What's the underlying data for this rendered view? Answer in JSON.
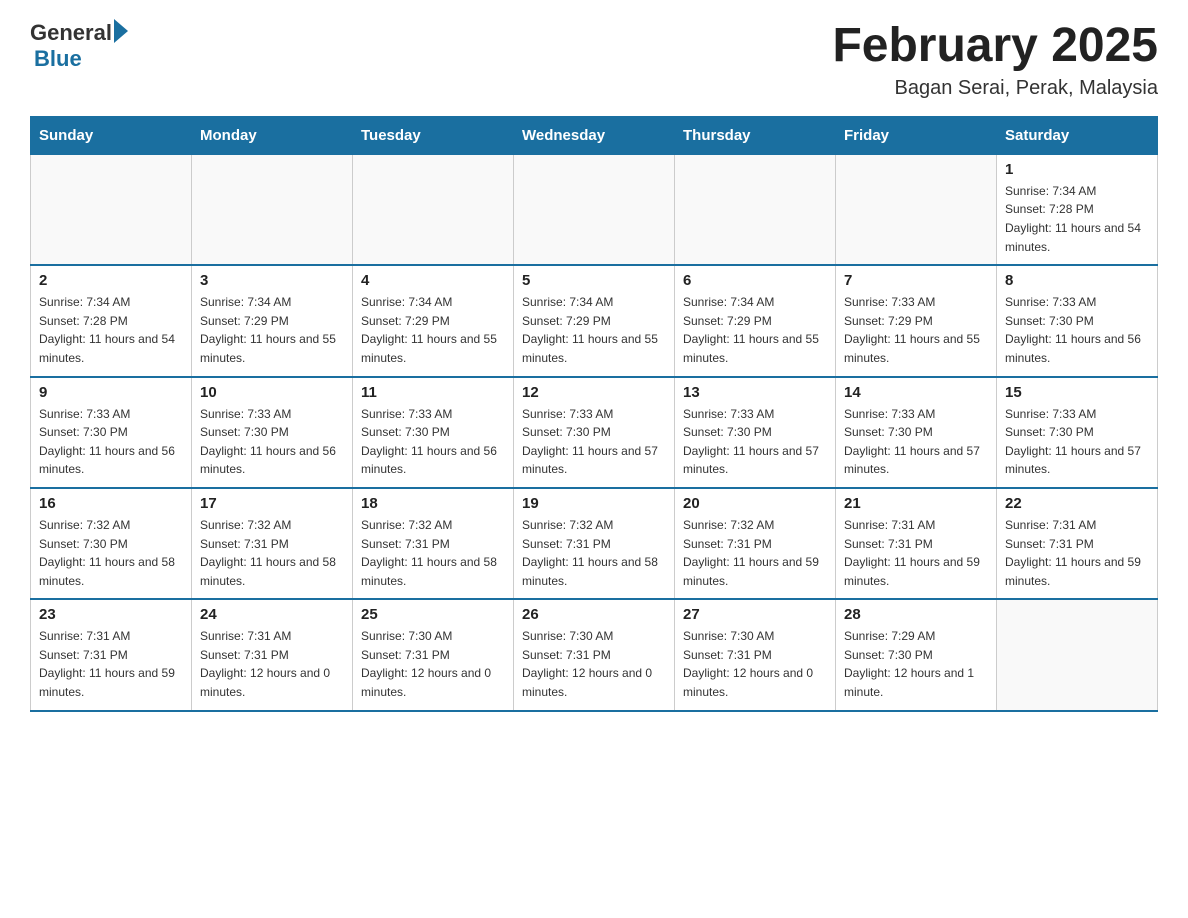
{
  "header": {
    "logo_general": "General",
    "logo_blue": "Blue",
    "month_title": "February 2025",
    "location": "Bagan Serai, Perak, Malaysia"
  },
  "days_of_week": [
    "Sunday",
    "Monday",
    "Tuesday",
    "Wednesday",
    "Thursday",
    "Friday",
    "Saturday"
  ],
  "weeks": [
    [
      {
        "day": "",
        "sunrise": "",
        "sunset": "",
        "daylight": ""
      },
      {
        "day": "",
        "sunrise": "",
        "sunset": "",
        "daylight": ""
      },
      {
        "day": "",
        "sunrise": "",
        "sunset": "",
        "daylight": ""
      },
      {
        "day": "",
        "sunrise": "",
        "sunset": "",
        "daylight": ""
      },
      {
        "day": "",
        "sunrise": "",
        "sunset": "",
        "daylight": ""
      },
      {
        "day": "",
        "sunrise": "",
        "sunset": "",
        "daylight": ""
      },
      {
        "day": "1",
        "sunrise": "Sunrise: 7:34 AM",
        "sunset": "Sunset: 7:28 PM",
        "daylight": "Daylight: 11 hours and 54 minutes."
      }
    ],
    [
      {
        "day": "2",
        "sunrise": "Sunrise: 7:34 AM",
        "sunset": "Sunset: 7:28 PM",
        "daylight": "Daylight: 11 hours and 54 minutes."
      },
      {
        "day": "3",
        "sunrise": "Sunrise: 7:34 AM",
        "sunset": "Sunset: 7:29 PM",
        "daylight": "Daylight: 11 hours and 55 minutes."
      },
      {
        "day": "4",
        "sunrise": "Sunrise: 7:34 AM",
        "sunset": "Sunset: 7:29 PM",
        "daylight": "Daylight: 11 hours and 55 minutes."
      },
      {
        "day": "5",
        "sunrise": "Sunrise: 7:34 AM",
        "sunset": "Sunset: 7:29 PM",
        "daylight": "Daylight: 11 hours and 55 minutes."
      },
      {
        "day": "6",
        "sunrise": "Sunrise: 7:34 AM",
        "sunset": "Sunset: 7:29 PM",
        "daylight": "Daylight: 11 hours and 55 minutes."
      },
      {
        "day": "7",
        "sunrise": "Sunrise: 7:33 AM",
        "sunset": "Sunset: 7:29 PM",
        "daylight": "Daylight: 11 hours and 55 minutes."
      },
      {
        "day": "8",
        "sunrise": "Sunrise: 7:33 AM",
        "sunset": "Sunset: 7:30 PM",
        "daylight": "Daylight: 11 hours and 56 minutes."
      }
    ],
    [
      {
        "day": "9",
        "sunrise": "Sunrise: 7:33 AM",
        "sunset": "Sunset: 7:30 PM",
        "daylight": "Daylight: 11 hours and 56 minutes."
      },
      {
        "day": "10",
        "sunrise": "Sunrise: 7:33 AM",
        "sunset": "Sunset: 7:30 PM",
        "daylight": "Daylight: 11 hours and 56 minutes."
      },
      {
        "day": "11",
        "sunrise": "Sunrise: 7:33 AM",
        "sunset": "Sunset: 7:30 PM",
        "daylight": "Daylight: 11 hours and 56 minutes."
      },
      {
        "day": "12",
        "sunrise": "Sunrise: 7:33 AM",
        "sunset": "Sunset: 7:30 PM",
        "daylight": "Daylight: 11 hours and 57 minutes."
      },
      {
        "day": "13",
        "sunrise": "Sunrise: 7:33 AM",
        "sunset": "Sunset: 7:30 PM",
        "daylight": "Daylight: 11 hours and 57 minutes."
      },
      {
        "day": "14",
        "sunrise": "Sunrise: 7:33 AM",
        "sunset": "Sunset: 7:30 PM",
        "daylight": "Daylight: 11 hours and 57 minutes."
      },
      {
        "day": "15",
        "sunrise": "Sunrise: 7:33 AM",
        "sunset": "Sunset: 7:30 PM",
        "daylight": "Daylight: 11 hours and 57 minutes."
      }
    ],
    [
      {
        "day": "16",
        "sunrise": "Sunrise: 7:32 AM",
        "sunset": "Sunset: 7:30 PM",
        "daylight": "Daylight: 11 hours and 58 minutes."
      },
      {
        "day": "17",
        "sunrise": "Sunrise: 7:32 AM",
        "sunset": "Sunset: 7:31 PM",
        "daylight": "Daylight: 11 hours and 58 minutes."
      },
      {
        "day": "18",
        "sunrise": "Sunrise: 7:32 AM",
        "sunset": "Sunset: 7:31 PM",
        "daylight": "Daylight: 11 hours and 58 minutes."
      },
      {
        "day": "19",
        "sunrise": "Sunrise: 7:32 AM",
        "sunset": "Sunset: 7:31 PM",
        "daylight": "Daylight: 11 hours and 58 minutes."
      },
      {
        "day": "20",
        "sunrise": "Sunrise: 7:32 AM",
        "sunset": "Sunset: 7:31 PM",
        "daylight": "Daylight: 11 hours and 59 minutes."
      },
      {
        "day": "21",
        "sunrise": "Sunrise: 7:31 AM",
        "sunset": "Sunset: 7:31 PM",
        "daylight": "Daylight: 11 hours and 59 minutes."
      },
      {
        "day": "22",
        "sunrise": "Sunrise: 7:31 AM",
        "sunset": "Sunset: 7:31 PM",
        "daylight": "Daylight: 11 hours and 59 minutes."
      }
    ],
    [
      {
        "day": "23",
        "sunrise": "Sunrise: 7:31 AM",
        "sunset": "Sunset: 7:31 PM",
        "daylight": "Daylight: 11 hours and 59 minutes."
      },
      {
        "day": "24",
        "sunrise": "Sunrise: 7:31 AM",
        "sunset": "Sunset: 7:31 PM",
        "daylight": "Daylight: 12 hours and 0 minutes."
      },
      {
        "day": "25",
        "sunrise": "Sunrise: 7:30 AM",
        "sunset": "Sunset: 7:31 PM",
        "daylight": "Daylight: 12 hours and 0 minutes."
      },
      {
        "day": "26",
        "sunrise": "Sunrise: 7:30 AM",
        "sunset": "Sunset: 7:31 PM",
        "daylight": "Daylight: 12 hours and 0 minutes."
      },
      {
        "day": "27",
        "sunrise": "Sunrise: 7:30 AM",
        "sunset": "Sunset: 7:31 PM",
        "daylight": "Daylight: 12 hours and 0 minutes."
      },
      {
        "day": "28",
        "sunrise": "Sunrise: 7:29 AM",
        "sunset": "Sunset: 7:30 PM",
        "daylight": "Daylight: 12 hours and 1 minute."
      },
      {
        "day": "",
        "sunrise": "",
        "sunset": "",
        "daylight": ""
      }
    ]
  ]
}
